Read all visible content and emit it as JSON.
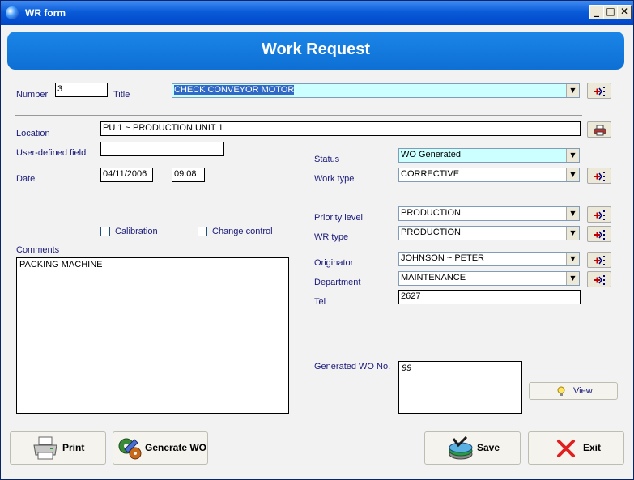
{
  "window": {
    "title": "WR form",
    "minimize": "_",
    "maximize": "□",
    "close": "✕"
  },
  "header": {
    "title": "Work Request"
  },
  "form": {
    "number_label": "Number",
    "number_value": "3",
    "title_label": "Title",
    "title_value": "CHECK CONVEYOR MOTOR",
    "location_label": "Location",
    "location_value": "PU 1 ~ PRODUCTION UNIT 1",
    "user_field_label": "User-defined field",
    "user_field_value": "",
    "date_label": "Date",
    "date_value": "04/11/2006",
    "time_value": "09:08",
    "status_label": "Status",
    "status_value": "WO Generated",
    "work_type_label": "Work type",
    "work_type_value": "CORRECTIVE",
    "calibration_label": "Calibration",
    "change_control_label": "Change control",
    "priority_label": "Priority level",
    "priority_value": "PRODUCTION",
    "wr_type_label": "WR type",
    "wr_type_value": "PRODUCTION",
    "comments_label": "Comments",
    "comments_value": "PACKING MACHINE",
    "originator_label": "Originator",
    "originator_value": "JOHNSON ~ PETER",
    "department_label": "Department",
    "department_value": "MAINTENANCE",
    "tel_label": "Tel",
    "tel_value": "2627",
    "generated_wo_label": "Generated WO No.",
    "generated_wo_value": "99"
  },
  "buttons": {
    "view": "View",
    "print": "Print",
    "generate_wo": "Generate WO",
    "save": "Save",
    "exit": "Exit"
  },
  "colors": {
    "titlebar": "#0a5bd8",
    "banner": "#0d6fd4",
    "highlight_field": "#ccffff",
    "label_text": "#1a1a7a"
  },
  "icons": {
    "app": "app-icon",
    "pick": "list-picker-icon",
    "printer_small": "printer-icon",
    "bulb": "lightbulb-icon",
    "print": "printer-icon",
    "generate": "gears-icon",
    "save": "save-disk-icon",
    "exit": "red-x-icon"
  }
}
